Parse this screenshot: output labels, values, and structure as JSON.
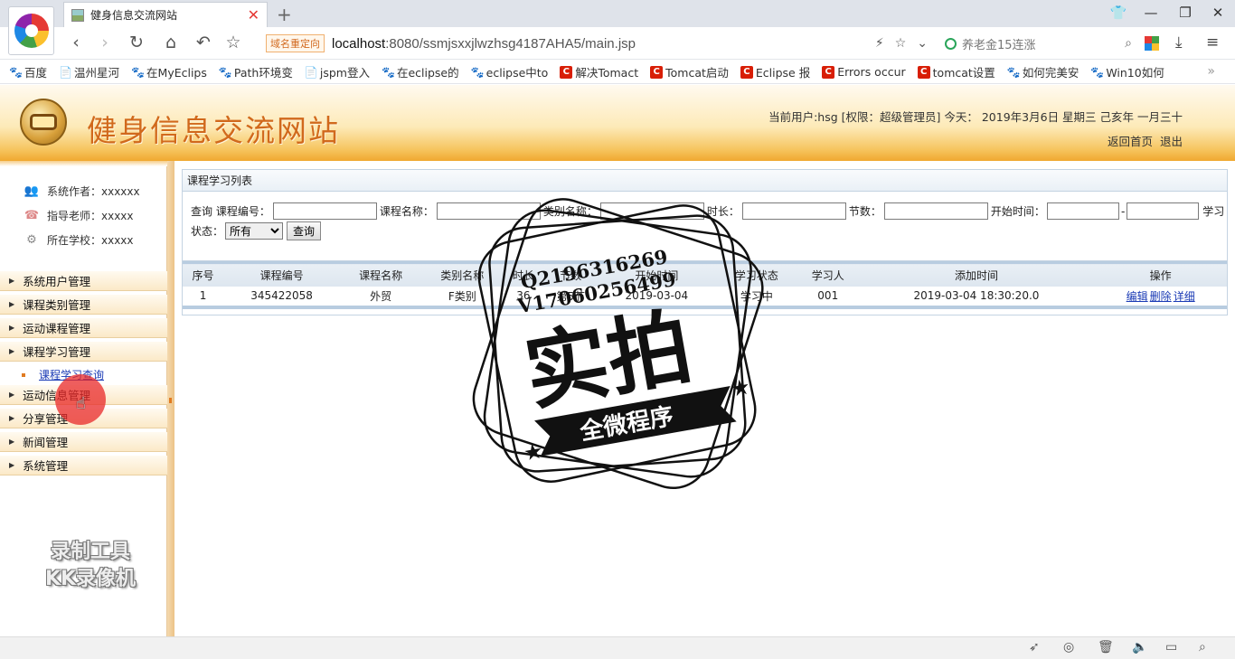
{
  "browser": {
    "tab_title": "健身信息交流网站",
    "new_tab": "+",
    "url_badge": "域名重定向",
    "url_host": "localhost",
    "url_rest": ":8080/ssmjsxxjlwzhsg4187AHA5/main.jsp",
    "search_text": "养老金15连涨",
    "bookmarks": [
      {
        "icon": "paw",
        "label": "百度"
      },
      {
        "icon": "page",
        "label": "温州星河"
      },
      {
        "icon": "paw",
        "label": "在MyEclips"
      },
      {
        "icon": "paw",
        "label": "Path环境变"
      },
      {
        "icon": "page",
        "label": "jspm登入"
      },
      {
        "icon": "paw",
        "label": "在eclipse的"
      },
      {
        "icon": "paw",
        "label": "eclipse中to"
      },
      {
        "icon": "csdn",
        "label": "解决Tomact"
      },
      {
        "icon": "csdn",
        "label": "Tomcat启动"
      },
      {
        "icon": "csdn",
        "label": "Eclipse 报"
      },
      {
        "icon": "csdn",
        "label": "Errors occur"
      },
      {
        "icon": "csdn",
        "label": "tomcat设置"
      },
      {
        "icon": "paw",
        "label": "如何完美安"
      },
      {
        "icon": "paw",
        "label": "Win10如何"
      }
    ],
    "bookmarks_more": "»"
  },
  "header": {
    "site_title": "健身信息交流网站",
    "user_info": "当前用户:hsg [权限：超级管理员] 今天： 2019年3月6日 星期三 己亥年 一月三十",
    "link_home": "返回首页",
    "link_logout": "退出"
  },
  "sidebar": {
    "info": [
      {
        "label": "系统作者：xxxxxx"
      },
      {
        "label": "指导老师：xxxxx"
      },
      {
        "label": "所在学校：xxxxx"
      }
    ],
    "menu": [
      {
        "label": "系统用户管理"
      },
      {
        "label": "课程类别管理"
      },
      {
        "label": "运动课程管理"
      },
      {
        "label": "课程学习管理"
      },
      {
        "label": "运动信息管理"
      },
      {
        "label": "分享管理"
      },
      {
        "label": "新闻管理"
      },
      {
        "label": "系统管理"
      }
    ],
    "sub_item": "课程学习查询",
    "watermark_line1": "录制工具",
    "watermark_line2": "KK录像机"
  },
  "main": {
    "panel_title": "课程学习列表",
    "search": {
      "prefix": "查询",
      "course_no_label": "课程编号：",
      "course_name_label": "课程名称：",
      "category_label": "类别名称：",
      "duration_label": "时长：",
      "sections_label": "节数：",
      "start_time_label": "开始时间：",
      "range_sep": "-",
      "study_label": "学习",
      "status_label": "状态：",
      "status_value": "所有",
      "query_button": "查询"
    },
    "columns": [
      "序号",
      "课程编号",
      "课程名称",
      "类别名称",
      "时长",
      "节数",
      "开始时间",
      "学习状态",
      "学习人",
      "添加时间",
      "操作"
    ],
    "rows": [
      {
        "cells": [
          "1",
          "345422058",
          "外贸",
          "F类别",
          "36",
          "第5节",
          "2019-03-04",
          "学习中",
          "001",
          "2019-03-04 18:30:20.0"
        ],
        "actions": [
          "编辑",
          "删除",
          "详细"
        ]
      }
    ]
  },
  "stamp": {
    "line1": "Q2196316269",
    "line2": "V17060256499",
    "main": "实拍",
    "ribbon": "全微程序"
  },
  "colors": {
    "site_title": "#d1691c",
    "header_gradient_end": "#f0a830",
    "link_blue": "#1b3bb5",
    "table_header_bg": "#dde6ef"
  }
}
